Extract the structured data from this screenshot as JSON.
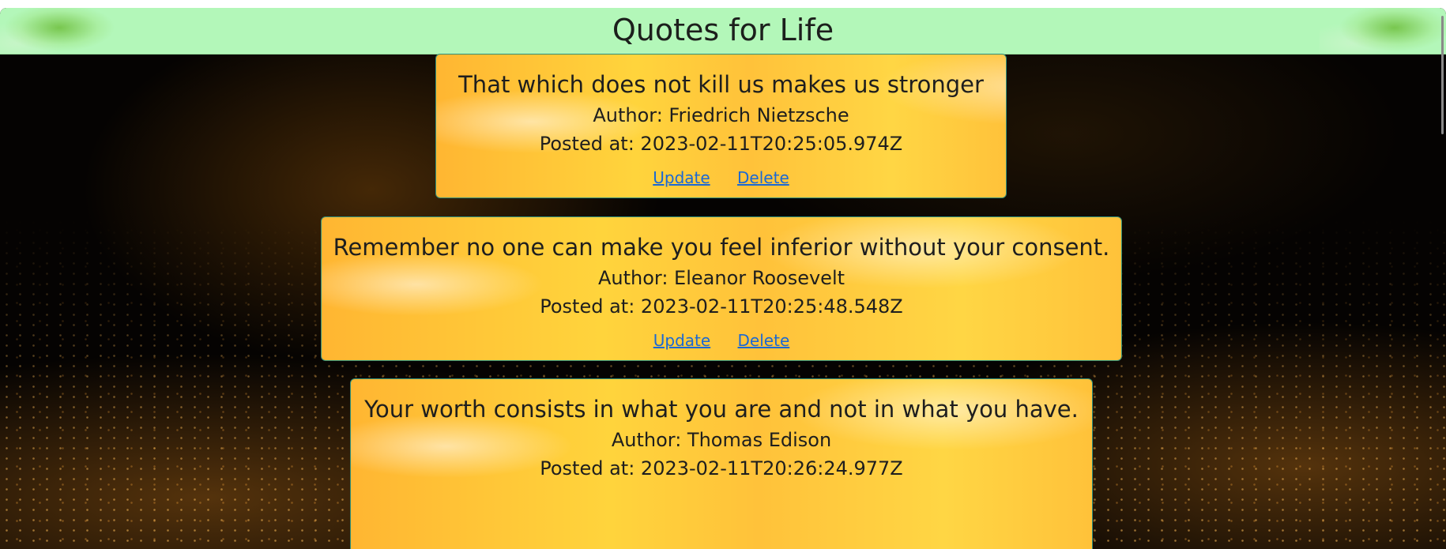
{
  "header": {
    "title": "Quotes for Life"
  },
  "quotes": [
    {
      "text": "That which does not kill us makes us stronger",
      "author": "Author: Friedrich Nietzsche",
      "posted": "Posted at: 2023-02-11T20:25:05.974Z",
      "update_label": "Update",
      "delete_label": "Delete"
    },
    {
      "text": "Remember no one can make you feel inferior without your consent.",
      "author": "Author: Eleanor Roosevelt",
      "posted": "Posted at: 2023-02-11T20:25:48.548Z",
      "update_label": "Update",
      "delete_label": "Delete"
    },
    {
      "text": "Your worth consists in what you are and not in what you have.",
      "author": "Author: Thomas Edison",
      "posted": "Posted at: 2023-02-11T20:26:24.977Z"
    }
  ],
  "colors": {
    "header_bg": "#b3f7b9",
    "card_bg": "#ffc83a",
    "link": "#1a68d4",
    "page_bg": "#050302"
  }
}
